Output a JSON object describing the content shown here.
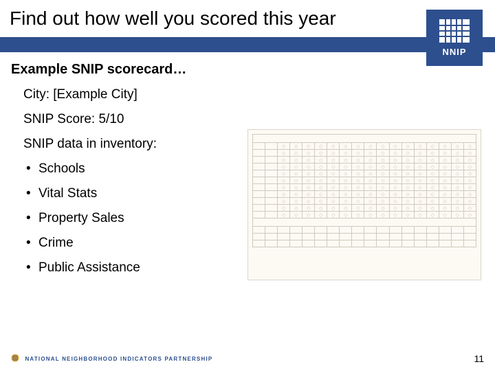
{
  "header": {
    "title": "Find out how well you scored this year"
  },
  "logo": {
    "text": "NNIP"
  },
  "subheading": "Example SNIP scorecard…",
  "lines": {
    "city": "City: [Example City]",
    "score": "SNIP Score: 5/10",
    "inventory": "SNIP data in inventory:"
  },
  "bullets": [
    "Schools",
    "Vital Stats",
    "Property Sales",
    "Crime",
    "Public Assistance"
  ],
  "footer": {
    "brand": "NATIONAL NEIGHBORHOOD INDICATORS PARTNERSHIP",
    "page": "11"
  }
}
